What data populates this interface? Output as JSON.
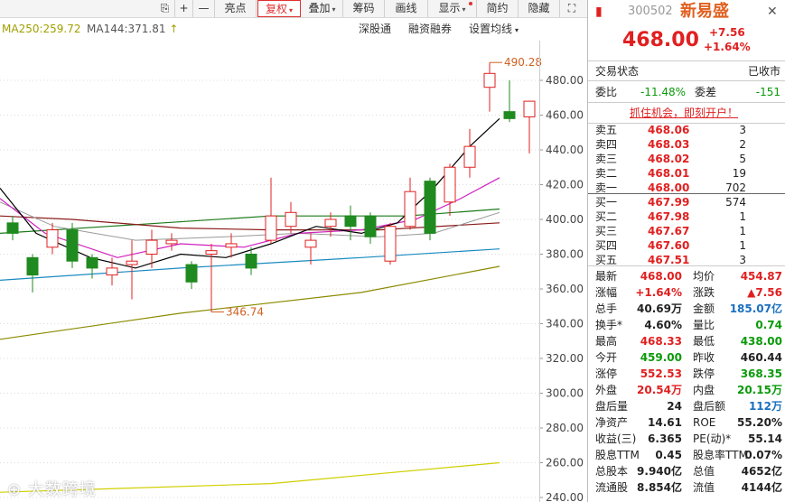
{
  "toolbar": {
    "items": [
      {
        "label": "亮点",
        "dropdown": false
      },
      {
        "label": "复权",
        "dropdown": true,
        "active": true
      },
      {
        "label": "叠加",
        "dropdown": true
      },
      {
        "label": "筹码",
        "dropdown": false
      },
      {
        "label": "画线",
        "dropdown": false
      },
      {
        "label": "显示",
        "dropdown": true
      },
      {
        "label": "简约",
        "dropdown": false
      },
      {
        "label": "隐藏",
        "dropdown": false
      }
    ],
    "plus": "+",
    "minus": "—"
  },
  "ma_bar": {
    "ma250": "MA250:259.72",
    "ma144": "MA144:371.81",
    "arrow": "↑",
    "links": [
      "深股通",
      "融资融券",
      "设置均线"
    ]
  },
  "chart_data": {
    "type": "candlestick",
    "y_ticks": [
      "480.00",
      "460.00",
      "440.00",
      "420.00",
      "400.00",
      "380.00",
      "360.00",
      "340.00",
      "320.00",
      "300.00",
      "280.00",
      "260.00",
      "240.00"
    ],
    "ylim": [
      240,
      490
    ],
    "annotations": {
      "high": "490.28",
      "low": "346.74"
    },
    "candles": [
      {
        "o": 398,
        "c": 392,
        "h": 402,
        "l": 388
      },
      {
        "o": 378,
        "c": 368,
        "h": 380,
        "l": 358
      },
      {
        "o": 384,
        "c": 394,
        "h": 398,
        "l": 380
      },
      {
        "o": 394,
        "c": 376,
        "h": 398,
        "l": 372
      },
      {
        "o": 378,
        "c": 372,
        "h": 380,
        "l": 366
      },
      {
        "o": 368,
        "c": 372,
        "h": 378,
        "l": 362
      },
      {
        "o": 374,
        "c": 376,
        "h": 388,
        "l": 354
      },
      {
        "o": 380,
        "c": 388,
        "h": 394,
        "l": 372
      },
      {
        "o": 386,
        "c": 388,
        "h": 392,
        "l": 382
      },
      {
        "o": 374,
        "c": 364,
        "h": 376,
        "l": 360
      },
      {
        "o": 380,
        "c": 382,
        "h": 386,
        "l": 346.74
      },
      {
        "o": 384,
        "c": 386,
        "h": 392,
        "l": 378
      },
      {
        "o": 380,
        "c": 372,
        "h": 384,
        "l": 368
      },
      {
        "o": 388,
        "c": 402,
        "h": 424,
        "l": 386
      },
      {
        "o": 396,
        "c": 404,
        "h": 410,
        "l": 392
      },
      {
        "o": 384,
        "c": 388,
        "h": 392,
        "l": 374
      },
      {
        "o": 396,
        "c": 400,
        "h": 404,
        "l": 390
      },
      {
        "o": 402,
        "c": 396,
        "h": 408,
        "l": 388
      },
      {
        "o": 402,
        "c": 390,
        "h": 404,
        "l": 386
      },
      {
        "o": 376,
        "c": 396,
        "h": 398,
        "l": 374
      },
      {
        "o": 396,
        "c": 416,
        "h": 424,
        "l": 394
      },
      {
        "o": 422,
        "c": 392,
        "h": 424,
        "l": 388
      },
      {
        "o": 410,
        "c": 430,
        "h": 432,
        "l": 402
      },
      {
        "o": 430,
        "c": 442,
        "h": 452,
        "l": 424
      },
      {
        "o": 476,
        "c": 484,
        "h": 490.28,
        "l": 462
      },
      {
        "o": 462,
        "c": 458,
        "h": 480,
        "l": 456
      },
      {
        "o": 459,
        "c": 468,
        "h": 468.33,
        "l": 438
      }
    ]
  },
  "quote": {
    "code": "300502",
    "name": "新易盛",
    "price": "468.00",
    "change": "+7.56",
    "change_pct": "+1.64%",
    "status_label": "交易状态",
    "status": "已收市",
    "webi_label": "委比",
    "webi": "-11.48%",
    "weicha_label": "委差",
    "weicha": "-151",
    "promo": "抓住机会，即刻开户！"
  },
  "order_book": {
    "asks": [
      {
        "label": "卖五",
        "price": "468.06",
        "vol": "3"
      },
      {
        "label": "卖四",
        "price": "468.03",
        "vol": "2"
      },
      {
        "label": "卖三",
        "price": "468.02",
        "vol": "5"
      },
      {
        "label": "卖二",
        "price": "468.01",
        "vol": "19"
      },
      {
        "label": "卖一",
        "price": "468.00",
        "vol": "702"
      }
    ],
    "bids": [
      {
        "label": "买一",
        "price": "467.99",
        "vol": "574"
      },
      {
        "label": "买二",
        "price": "467.98",
        "vol": "1"
      },
      {
        "label": "买三",
        "price": "467.67",
        "vol": "1"
      },
      {
        "label": "买四",
        "price": "467.60",
        "vol": "1"
      },
      {
        "label": "买五",
        "price": "467.51",
        "vol": "3"
      }
    ]
  },
  "stats": [
    {
      "l1": "最新",
      "v1": "468.00",
      "c1": "red",
      "l2": "均价",
      "v2": "454.87",
      "c2": "red"
    },
    {
      "l1": "涨幅",
      "v1": "+1.64%",
      "c1": "red",
      "l2": "涨跌",
      "v2": "▲7.56",
      "c2": "red"
    },
    {
      "l1": "总手",
      "v1": "40.69万",
      "c1": "",
      "l2": "金额",
      "v2": "185.07亿",
      "c2": "blue"
    },
    {
      "l1": "换手*",
      "v1": "4.60%",
      "c1": "",
      "l2": "量比",
      "v2": "0.74",
      "c2": "green"
    },
    {
      "l1": "最高",
      "v1": "468.33",
      "c1": "red",
      "l2": "最低",
      "v2": "438.00",
      "c2": "green"
    },
    {
      "l1": "今开",
      "v1": "459.00",
      "c1": "green",
      "l2": "昨收",
      "v2": "460.44",
      "c2": ""
    },
    {
      "l1": "涨停",
      "v1": "552.53",
      "c1": "red",
      "l2": "跌停",
      "v2": "368.35",
      "c2": "green"
    },
    {
      "l1": "外盘",
      "v1": "20.54万",
      "c1": "red",
      "l2": "内盘",
      "v2": "20.15万",
      "c2": "green"
    },
    {
      "l1": "盘后量",
      "v1": "24",
      "c1": "",
      "l2": "盘后额",
      "v2": "112万",
      "c2": "blue"
    },
    {
      "l1": "净资产",
      "v1": "14.61",
      "c1": "",
      "l2": "ROE",
      "v2": "55.20%",
      "c2": ""
    },
    {
      "l1": "收益(三)",
      "v1": "6.365",
      "c1": "",
      "l2": "PE(动)*",
      "v2": "55.14",
      "c2": ""
    },
    {
      "l1": "股息TTM",
      "v1": "0.45",
      "c1": "",
      "l2": "股息率TTM",
      "v2": "0.07%",
      "c2": ""
    },
    {
      "l1": "总股本",
      "v1": "9.940亿",
      "c1": "",
      "l2": "总值",
      "v2": "4652亿",
      "c2": ""
    },
    {
      "l1": "流通股",
      "v1": "8.854亿",
      "c1": "",
      "l2": "流值",
      "v2": "4144亿",
      "c2": ""
    }
  ],
  "watermark": "大数跨境",
  "colors": {
    "up": "#e02020",
    "down": "#1f8a1f",
    "ma5": "#000000",
    "ma10": "#d020c0",
    "ma20": "#999999",
    "ma30": "#1a7a1a",
    "ma60": "#8b1a1a",
    "ma120": "#1a8ac0",
    "ma144": "#8a8a00",
    "ma250": "#cfcf00"
  }
}
